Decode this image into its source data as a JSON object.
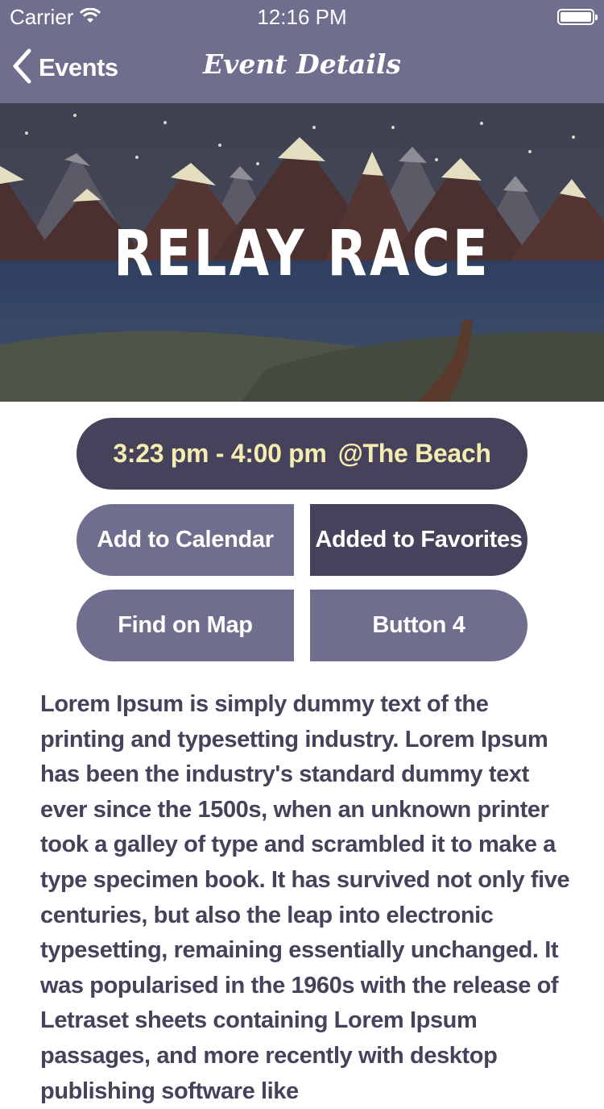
{
  "status_bar": {
    "carrier": "Carrier",
    "time": "12:16 PM",
    "icons": [
      "wifi-icon",
      "battery-icon"
    ]
  },
  "nav": {
    "back_label": "Events",
    "title": "Event Details",
    "back_icon": "chevron-left-icon"
  },
  "hero": {
    "title": "RELAY RACE"
  },
  "event": {
    "time": "3:23 pm - 4:00 pm",
    "location": "@The Beach"
  },
  "actions": {
    "add_to_calendar": "Add to Calendar",
    "added_to_favorites": "Added to Favorites",
    "find_on_map": "Find on Map",
    "button_4": "Button 4"
  },
  "description": "Lorem Ipsum is simply dummy text of the printing and typesetting industry. Lorem Ipsum has been the industry's standard dummy text ever since the 1500s, when an unknown printer took a galley of type and scrambled it to make a type specimen book. It has survived not only five centuries, but also the leap into electronic typesetting, remaining essentially unchanged. It was popularised in the 1960s with the release of Letraset sheets containing Lorem Ipsum passages, and more recently with desktop publishing software like",
  "colors": {
    "nav_bar": "#6f6e8f",
    "dark_button": "#46425c",
    "light_button": "#6f6e8f",
    "time_text": "#f5edb0",
    "body_text": "#46425c"
  }
}
